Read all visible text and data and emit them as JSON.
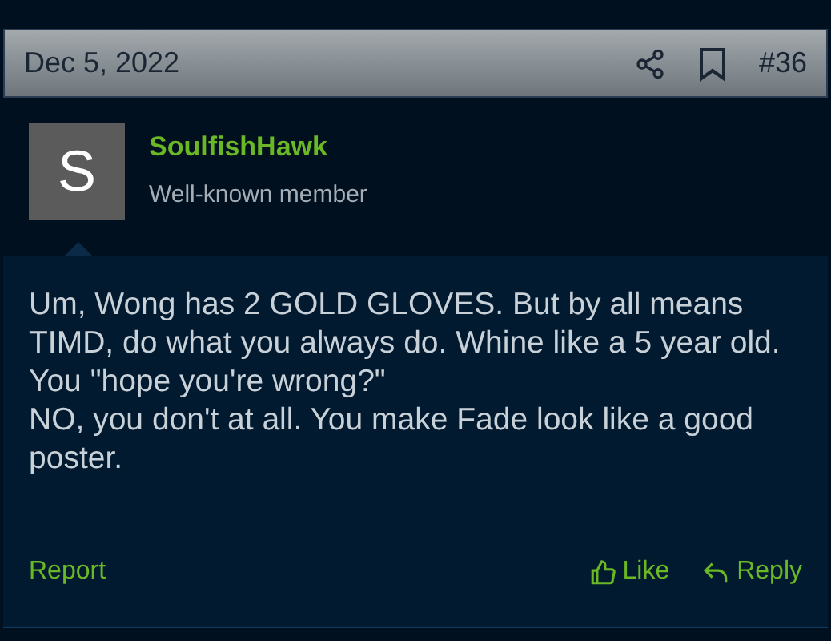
{
  "post_header": {
    "date": "Dec 5, 2022",
    "number": "#36"
  },
  "author": {
    "avatar_letter": "S",
    "name": "SoulfishHawk",
    "title": "Well-known member"
  },
  "message": {
    "paragraphs": [
      "Um, Wong has 2 GOLD GLOVES. But by all means TIMD, do what you always do. Whine like a 5 year old. You \"hope you're wrong?\"",
      "NO, you don't at all. You make Fade look like a good poster."
    ]
  },
  "actions": {
    "report": "Report",
    "like": "Like",
    "reply": "Reply"
  }
}
